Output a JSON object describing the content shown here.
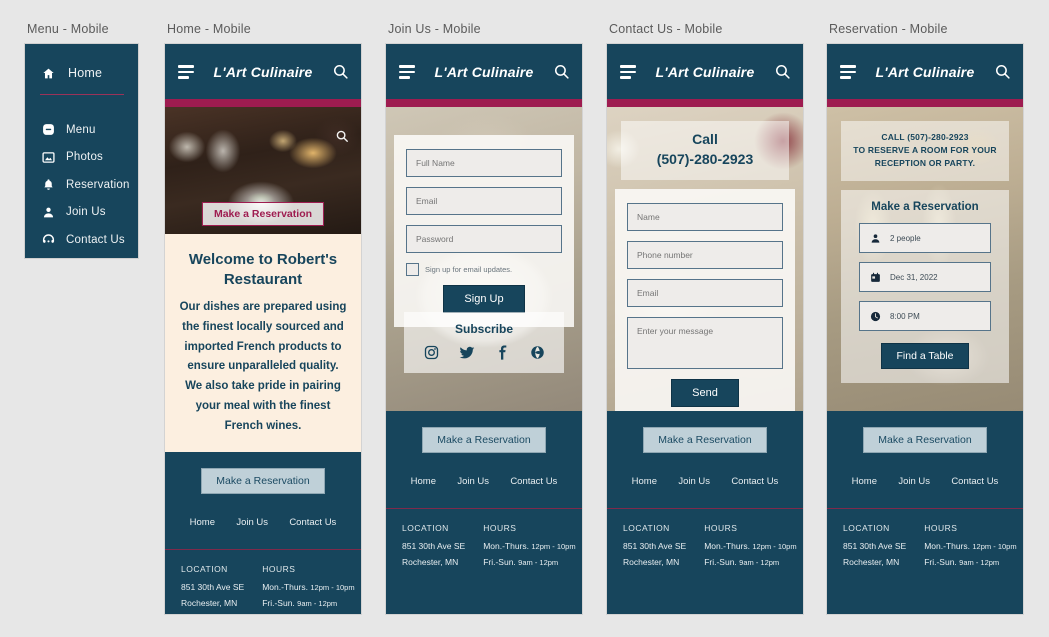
{
  "brand": "L'Art Culinaire",
  "accent_color": "#9e1c50",
  "primary_color": "#17455c",
  "panels": {
    "menu": "Menu - Mobile",
    "home": "Home - Mobile",
    "join": "Join Us - Mobile",
    "contact": "Contact Us - Mobile",
    "reservation": "Reservation - Mobile"
  },
  "drawer": {
    "home_label": "Home",
    "items": [
      {
        "label": "Menu",
        "icon": "menu-circle-icon"
      },
      {
        "label": "Photos",
        "icon": "photo-icon"
      },
      {
        "label": "Reservation",
        "icon": "bell-icon"
      },
      {
        "label": "Join Us",
        "icon": "person-icon"
      },
      {
        "label": "Contact Us",
        "icon": "headset-icon"
      }
    ]
  },
  "home": {
    "hero_cta": "Make a Reservation",
    "welcome_title": "Welcome to Robert's Restaurant",
    "welcome_body": "Our dishes are prepared using the finest locally sourced and imported French products to ensure unparalleled quality. We also take pride in pairing your meal with the finest French wines."
  },
  "join": {
    "full_name_placeholder": "Full Name",
    "email_placeholder": "Email",
    "password_placeholder": "Password",
    "checkbox_label": "Sign up for email updates.",
    "signup_button": "Sign Up",
    "subscribe_title": "Subscribe",
    "socials": [
      "instagram-icon",
      "twitter-icon",
      "facebook-icon",
      "globe-icon"
    ]
  },
  "contact": {
    "call_label": "Call",
    "phone": "(507)-280-2923",
    "name_placeholder": "Name",
    "phone_placeholder": "Phone number",
    "email_placeholder": "Email",
    "message_placeholder": "Enter your message",
    "send_button": "Send"
  },
  "reservation": {
    "notice_line1": "CALL  (507)-280-2923",
    "notice_line2": "TO RESERVE A ROOM FOR YOUR",
    "notice_line3": "RECEPTION OR PARTY.",
    "title": "Make a Reservation",
    "party_size": "2 people",
    "date": "Dec 31, 2022",
    "time": "8:00 PM",
    "find_button": "Find a Table"
  },
  "footer": {
    "cta": "Make a Reservation",
    "nav": [
      "Home",
      "Join Us",
      "Contact Us"
    ],
    "location_heading": "LOCATION",
    "location_line1": "851 30th Ave SE",
    "location_line2": "Rochester, MN",
    "hours_heading": "HOURS",
    "hours_line1": "Mon.-Thurs.",
    "hours_line1_time": "12pm - 10pm",
    "hours_line2": "Fri.-Sun.",
    "hours_line2_time": "9am - 12pm"
  }
}
